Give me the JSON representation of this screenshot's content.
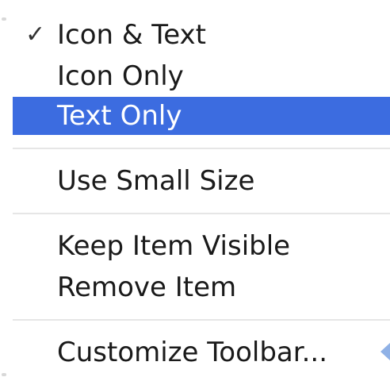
{
  "menu": {
    "items": [
      {
        "label": "Icon & Text",
        "checked": true,
        "check_glyph": "✓"
      },
      {
        "label": "Icon Only",
        "checked": false
      },
      {
        "label": "Text Only",
        "checked": false,
        "highlighted": true
      },
      {
        "label": "Use Small Size",
        "checked": false
      },
      {
        "label": "Keep Item Visible",
        "checked": false
      },
      {
        "label": "Remove Item",
        "checked": false
      },
      {
        "label": "Customize Toolbar...",
        "checked": false
      }
    ]
  },
  "colors": {
    "highlight": "#3c6ce0",
    "separator": "#e6e6e6",
    "text": "#1a1a1a"
  },
  "icons": {
    "check": "checkmark-icon",
    "pointer": "pointer-arrow-icon"
  }
}
